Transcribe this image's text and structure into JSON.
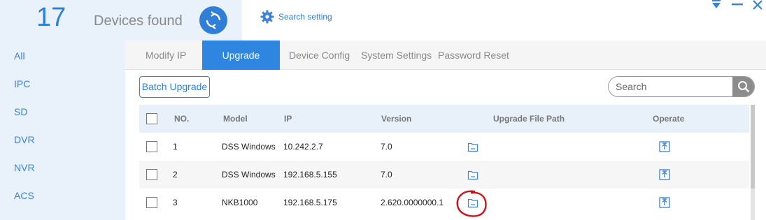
{
  "header": {
    "device_count": "17",
    "devices_found_label": "Devices found",
    "search_setting_label": "Search setting"
  },
  "sidebar": {
    "items": [
      {
        "label": "All"
      },
      {
        "label": "IPC"
      },
      {
        "label": "SD"
      },
      {
        "label": "DVR"
      },
      {
        "label": "NVR"
      },
      {
        "label": "ACS"
      }
    ]
  },
  "tabs": [
    {
      "label": "Modify IP"
    },
    {
      "label": "Upgrade"
    },
    {
      "label": "Device Config"
    },
    {
      "label": "System Settings"
    },
    {
      "label": "Password Reset"
    }
  ],
  "active_tab": "Upgrade",
  "toolbar": {
    "batch_upgrade_label": "Batch Upgrade",
    "search_placeholder": "Search"
  },
  "table": {
    "columns": [
      "NO.",
      "Model",
      "IP",
      "Version",
      "Upgrade File Path",
      "Operate"
    ],
    "rows": [
      {
        "no": "1",
        "model": "DSS Windows",
        "ip": "10.242.2.7",
        "version": "7.0"
      },
      {
        "no": "2",
        "model": "DSS Windows",
        "ip": "192.168.5.155",
        "version": "7.0"
      },
      {
        "no": "3",
        "model": "NKB1000",
        "ip": "192.168.5.175",
        "version": "2.620.0000000.1"
      }
    ]
  },
  "colors": {
    "accent": "#2f86e0",
    "sidebar_bg": "#e9f1fb",
    "annotation": "#d0101a"
  }
}
